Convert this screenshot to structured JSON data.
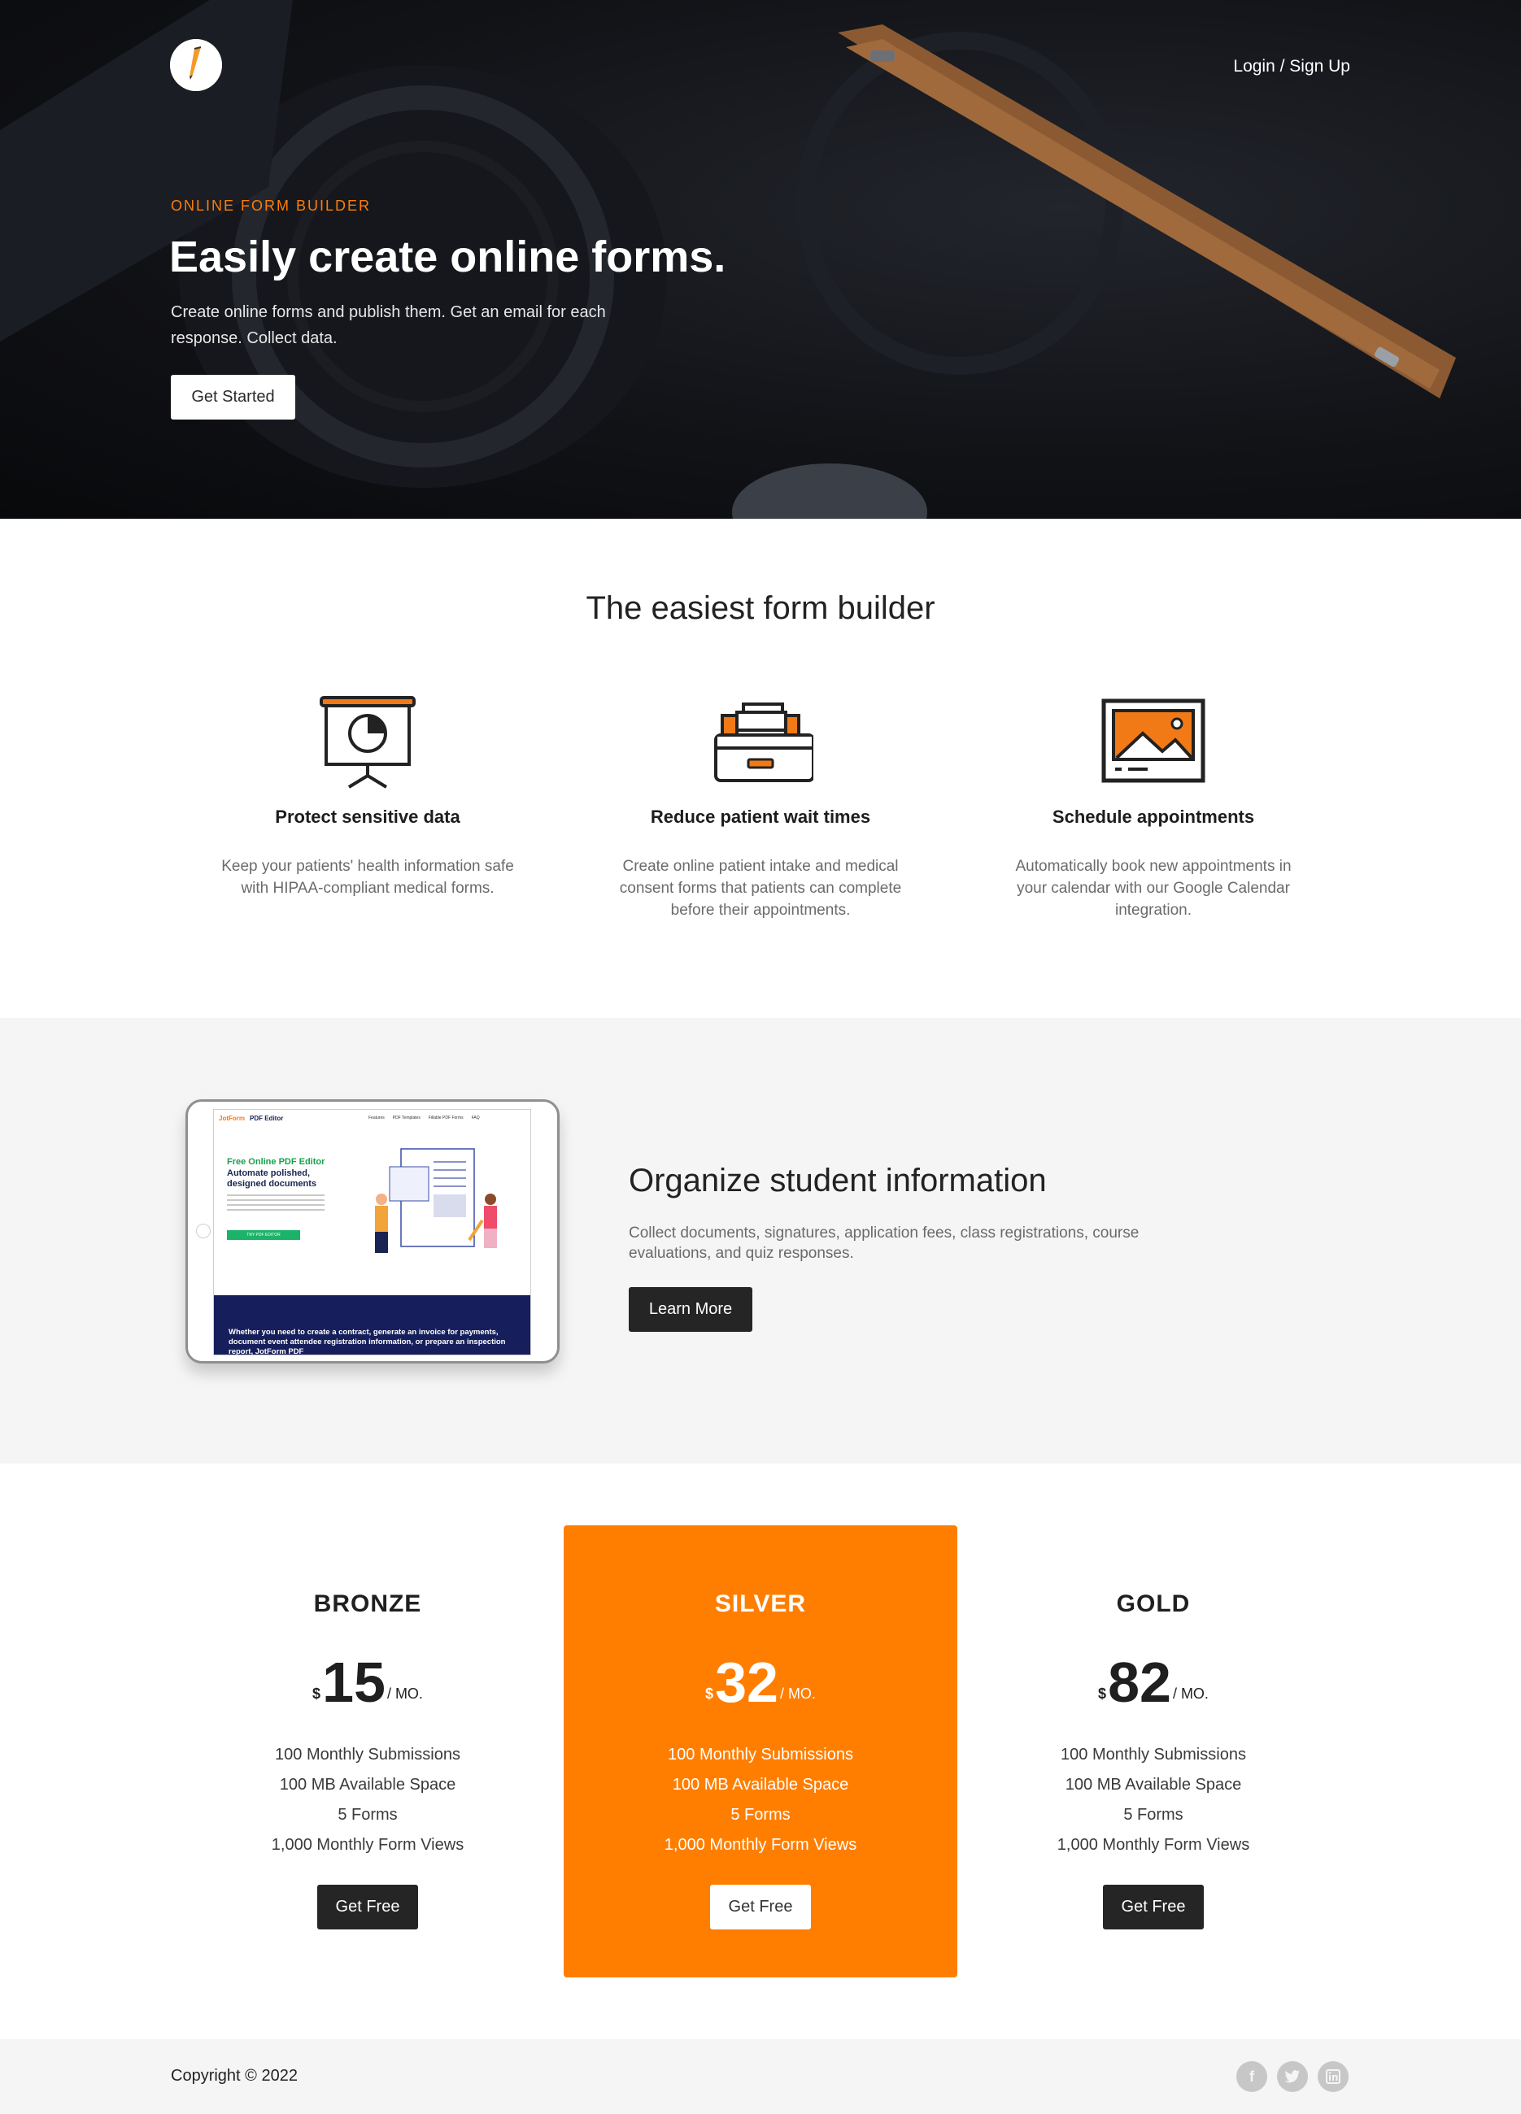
{
  "nav": {
    "login_label": "Login / Sign Up"
  },
  "hero": {
    "eyebrow": "ONLINE FORM BUILDER",
    "title": "Easily create online forms.",
    "subtitle": "Create online forms and publish them. Get an email for each response. Collect data.",
    "cta_label": "Get Started"
  },
  "features": {
    "title": "The easiest form builder",
    "items": [
      {
        "icon": "presentation-chart-icon",
        "title": "Protect sensitive data",
        "text": "Keep your patients' health information safe with HIPAA-compliant medical forms."
      },
      {
        "icon": "inbox-tray-icon",
        "title": "Reduce patient wait times",
        "text": "Create online patient intake and medical consent forms that patients can complete before their appointments."
      },
      {
        "icon": "image-frame-icon",
        "title": "Schedule appointments",
        "text": "Automatically book new appointments in your calendar with our Google Calendar integration."
      }
    ]
  },
  "organize": {
    "title": "Organize student information",
    "text": "Collect documents, signatures, application fees, class registrations, course evaluations, and quiz responses.",
    "cta_label": "Learn More",
    "screenshot": {
      "brand": "JotForm",
      "product": "PDF Editor",
      "nav": [
        "Features",
        "PDF Templates",
        "Fillable PDF Forms",
        "FAQ"
      ],
      "headline_accent": "Free Online PDF Editor",
      "headline": "Automate polished, designed documents",
      "button": "TRY PDF EDITOR",
      "banner": "Whether you need to create a contract, generate an invoice for payments, document event attendee registration information, or prepare an inspection report, JotForm PDF"
    }
  },
  "pricing": {
    "plans": [
      {
        "name": "BRONZE",
        "currency": "$",
        "amount": "15",
        "period": "/ MO.",
        "features": [
          "100 Monthly Submissions",
          "100 MB Available Space",
          "5 Forms",
          "1,000 Monthly Form Views"
        ],
        "cta_label": "Get Free"
      },
      {
        "name": "SILVER",
        "currency": "$",
        "amount": "32",
        "period": "/ MO.",
        "features": [
          "100 Monthly Submissions",
          "100 MB Available Space",
          "5 Forms",
          "1,000 Monthly Form Views"
        ],
        "cta_label": "Get Free"
      },
      {
        "name": "GOLD",
        "currency": "$",
        "amount": "82",
        "period": "/ MO.",
        "features": [
          "100 Monthly Submissions",
          "100 MB Available Space",
          "5 Forms",
          "1,000 Monthly Form Views"
        ],
        "cta_label": "Get Free"
      }
    ]
  },
  "footer": {
    "copyright": "Copyright © 2022",
    "social": [
      "facebook-icon",
      "twitter-icon",
      "linkedin-icon"
    ]
  },
  "colors": {
    "accent": "#ff7e00",
    "dark_button": "#252525",
    "section_bg": "#f5f5f5"
  }
}
